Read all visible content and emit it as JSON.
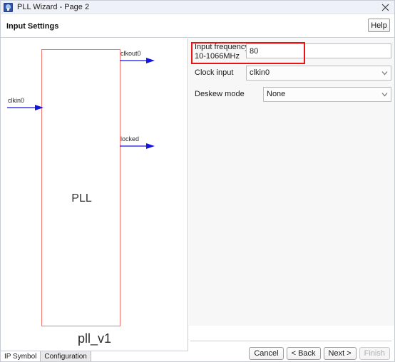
{
  "window": {
    "title": "PLL Wizard - Page 2",
    "app_icon": "pll-wizard-icon",
    "close_icon": "close-icon"
  },
  "header": {
    "page_title": "Input Settings",
    "help_label": "Help"
  },
  "canvas": {
    "block_label": "PLL",
    "module_name": "pll_v1",
    "block_border_color": "#f5756e",
    "wire_color": "#1414dc",
    "ports": [
      {
        "name": "clkin0",
        "direction": "input"
      },
      {
        "name": "clkout0",
        "direction": "output"
      },
      {
        "name": "locked",
        "direction": "output"
      }
    ],
    "tabs": [
      {
        "label": "IP Symbol",
        "active": true
      },
      {
        "label": "Configuration",
        "active": false
      }
    ]
  },
  "form": {
    "input_frequency": {
      "label_line1": "Input frequency",
      "label_line2": "10-1066MHz",
      "value": "80",
      "placeholder": ""
    },
    "clock_input": {
      "label": "Clock input",
      "value": "clkin0",
      "chevron_icon": "chevron-down-icon"
    },
    "deskew_mode": {
      "label": "Deskew mode",
      "value": "None",
      "chevron_icon": "chevron-down-icon"
    },
    "highlight_color": "#ee1111"
  },
  "footer": {
    "buttons": [
      {
        "label": "Cancel",
        "enabled": true
      },
      {
        "label": "< Back",
        "enabled": true
      },
      {
        "label": "Next >",
        "enabled": true
      },
      {
        "label": "Finish",
        "enabled": false
      }
    ]
  }
}
